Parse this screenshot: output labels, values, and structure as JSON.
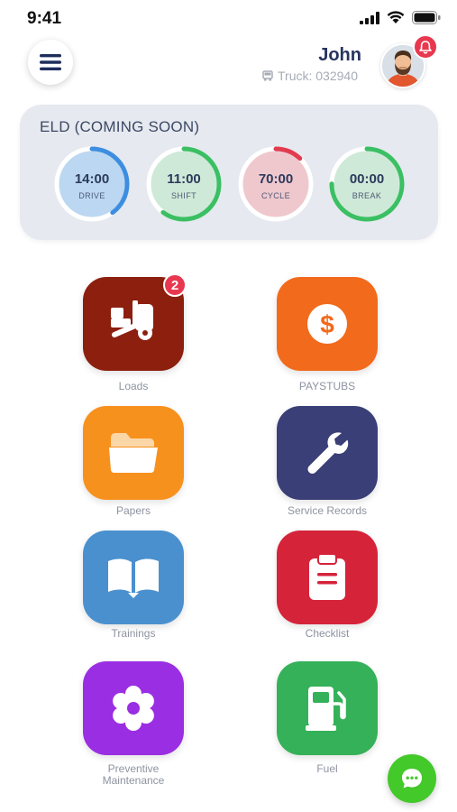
{
  "status_bar": {
    "time": "9:41"
  },
  "header": {
    "user_name": "John",
    "truck_label": "Truck: 032940",
    "notification_color": "#e8384f"
  },
  "eld": {
    "title": "ELD (COMING SOON)",
    "gauges": [
      {
        "value": "14:00",
        "label": "DRIVE",
        "fill_fraction": 0.4,
        "color": "#3d8ee0",
        "bg": "#bcd7f1"
      },
      {
        "value": "11:00",
        "label": "SHIFT",
        "fill_fraction": 0.6,
        "color": "#3bbf63",
        "bg": "#cfe9d8"
      },
      {
        "value": "70:00",
        "label": "CYCLE",
        "fill_fraction": 0.12,
        "color": "#e23a4e",
        "bg": "#efc8ce"
      },
      {
        "value": "00:00",
        "label": "BREAK",
        "fill_fraction": 0.75,
        "color": "#3bbf63",
        "bg": "#cfe9d8"
      }
    ]
  },
  "tiles": [
    {
      "label": "Loads",
      "icon": "dolly-icon",
      "color": "#8c1f0e",
      "badge": "2"
    },
    {
      "label": "PAYSTUBS",
      "icon": "dollar-icon",
      "color": "#f26a1b"
    },
    {
      "label": "Papers",
      "icon": "folder-icon",
      "color": "#f7911e"
    },
    {
      "label": "Service Records",
      "icon": "wrench-icon",
      "color": "#3a3f78"
    },
    {
      "label": "Trainings",
      "icon": "book-icon",
      "color": "#4a90cf"
    },
    {
      "label": "Checklist",
      "icon": "clipboard-icon",
      "color": "#d5233a"
    },
    {
      "label": "Preventive Maintenance",
      "icon": "gear-icon",
      "color": "#9a2ee3"
    },
    {
      "label": "Fuel",
      "icon": "fuel-pump-icon",
      "color": "#35b159"
    }
  ],
  "chat": {
    "icon": "chat-icon",
    "color": "#43c92a"
  }
}
